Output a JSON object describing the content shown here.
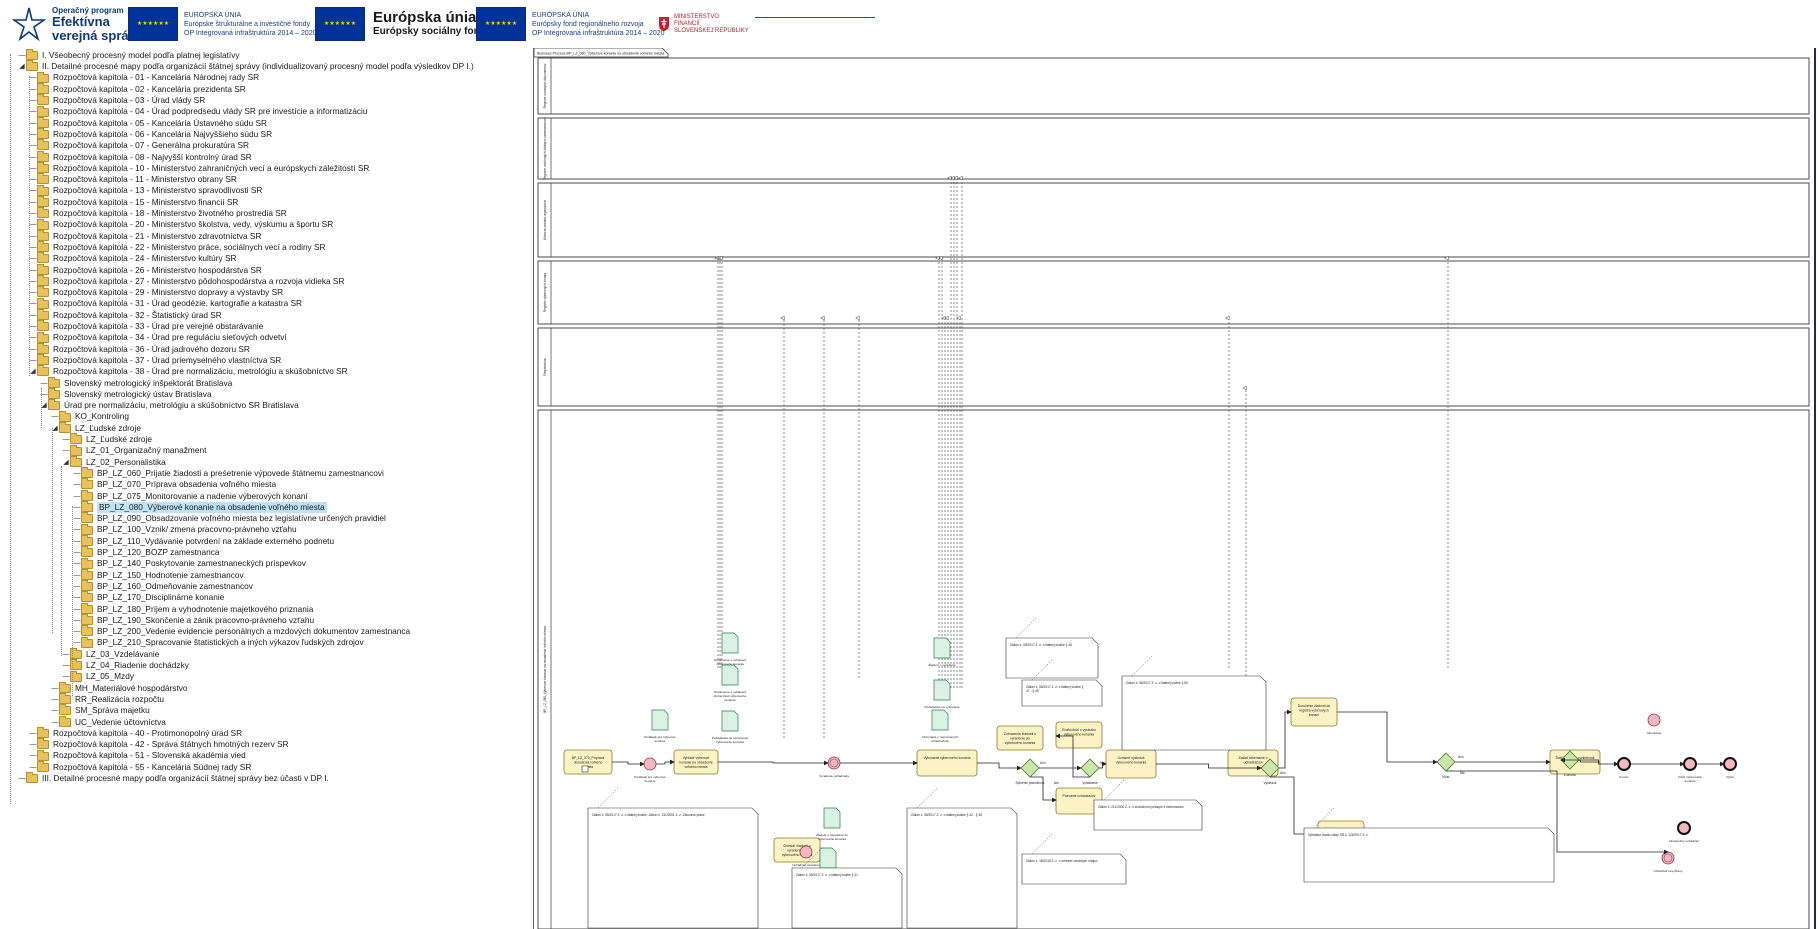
{
  "header": {
    "ovs": {
      "line1": "Operačný program",
      "line2": "Efektívna",
      "line3": "verejná správa"
    },
    "eu1": {
      "t1": "EURÓPSKA ÚNIA",
      "t2": "Európske štrukturálne a investičné fondy",
      "t3": "OP Integrovaná infraštruktúra 2014 – 2020"
    },
    "esf": {
      "title": "Európska únia",
      "sub": "Európsky sociálny fond"
    },
    "eu2": {
      "t1": "EURÓPSKA ÚNIA",
      "t2": "Európsky fond regionálneho rozvoja",
      "t3": "OP Integrovaná infraštruktúra 2014 – 2020"
    },
    "mf": {
      "t1": "MINISTERSTVO",
      "t2": "FINANCIÍ",
      "t3": "SLOVENSKEJ REPUBLIKY"
    },
    "colors": {
      "eu_blue": "#003399",
      "eu_star": "#ffcc00",
      "mf_red": "#b3202a",
      "ovs_blue": "#0d3b7a"
    }
  },
  "tree": [
    {
      "id": "n0",
      "label": "I. Všeobecný procesný model podľa platnej legislatívy",
      "level": 0,
      "toggle": "",
      "selected": false
    },
    {
      "id": "n1",
      "label": "II. Detailné procesné mapy podľa organizácií štátnej správy (individualizovaný procesný model podľa výsledkov DP I.)",
      "level": 0,
      "toggle": "◢",
      "selected": false
    },
    {
      "id": "n2",
      "label": "Rozpočtová kapitola - 01 - Kancelária Národnej rady SR",
      "level": 1,
      "toggle": "",
      "selected": false
    },
    {
      "id": "n3",
      "label": "Rozpočtová kapitola - 02 - Kancelária prezidenta SR",
      "level": 1,
      "toggle": "",
      "selected": false
    },
    {
      "id": "n4",
      "label": "Rozpočtová kapitola - 03 - Úrad vlády SR",
      "level": 1,
      "toggle": "",
      "selected": false
    },
    {
      "id": "n5",
      "label": "Rozpočtová kapitola - 04 - Úrad podpredsedu vlády SR pre investície a informatizáciu",
      "level": 1,
      "toggle": "",
      "selected": false
    },
    {
      "id": "n6",
      "label": "Rozpočtová kapitola - 05 - Kancelária Ústavného súdu SR",
      "level": 1,
      "toggle": "",
      "selected": false
    },
    {
      "id": "n7",
      "label": "Rozpočtová kapitola - 06 - Kancelária Najvyššieho súdu SR",
      "level": 1,
      "toggle": "",
      "selected": false
    },
    {
      "id": "n8",
      "label": "Rozpočtová kapitola - 07 - Generálna prokuratúra SR",
      "level": 1,
      "toggle": "",
      "selected": false
    },
    {
      "id": "n9",
      "label": "Rozpočtová kapitola - 08 - Najvyšší kontrolný úrad SR",
      "level": 1,
      "toggle": "",
      "selected": false
    },
    {
      "id": "n10",
      "label": "Rozpočtová kapitola - 10 - Ministerstvo zahraničných vecí a európskych záležitostí SR",
      "level": 1,
      "toggle": "",
      "selected": false
    },
    {
      "id": "n11",
      "label": "Rozpočtová kapitola - 11 - Ministerstvo obrany SR",
      "level": 1,
      "toggle": "",
      "selected": false
    },
    {
      "id": "n12",
      "label": "Rozpočtová kapitola - 13 - Ministerstvo spravodlivosti SR",
      "level": 1,
      "toggle": "",
      "selected": false
    },
    {
      "id": "n13",
      "label": "Rozpočtová kapitola - 15 - Ministerstvo financií SR",
      "level": 1,
      "toggle": "",
      "selected": false
    },
    {
      "id": "n14",
      "label": "Rozpočtová kapitola - 18 - Ministerstvo životného prostredia SR",
      "level": 1,
      "toggle": "",
      "selected": false
    },
    {
      "id": "n15",
      "label": "Rozpočtová kapitola - 20 - Ministerstvo školstva, vedy, výskumu a športu SR",
      "level": 1,
      "toggle": "",
      "selected": false
    },
    {
      "id": "n16",
      "label": "Rozpočtová kapitola - 21 - Ministerstvo zdravotníctva SR",
      "level": 1,
      "toggle": "",
      "selected": false
    },
    {
      "id": "n17",
      "label": "Rozpočtová kapitola - 22 - Ministerstvo práce, sociálnych vecí a rodiny SR",
      "level": 1,
      "toggle": "",
      "selected": false
    },
    {
      "id": "n18",
      "label": "Rozpočtová kapitola - 24 - Ministerstvo kultúry SR",
      "level": 1,
      "toggle": "",
      "selected": false
    },
    {
      "id": "n19",
      "label": "Rozpočtová kapitola - 26 - Ministerstvo hospodárstva SR",
      "level": 1,
      "toggle": "",
      "selected": false
    },
    {
      "id": "n20",
      "label": "Rozpočtová kapitola - 27 - Ministerstvo pôdohospodárstva a rozvoja vidieka SR",
      "level": 1,
      "toggle": "",
      "selected": false
    },
    {
      "id": "n21",
      "label": "Rozpočtová kapitola - 29 - Ministerstvo dopravy a výstavby SR",
      "level": 1,
      "toggle": "",
      "selected": false
    },
    {
      "id": "n22",
      "label": "Rozpočtová kapitola - 31 - Úrad geodézie, kartografie a katastra SR",
      "level": 1,
      "toggle": "",
      "selected": false
    },
    {
      "id": "n23",
      "label": "Rozpočtová kapitola - 32 - Štatistický úrad SR",
      "level": 1,
      "toggle": "",
      "selected": false
    },
    {
      "id": "n24",
      "label": "Rozpočtová kapitola - 33 - Úrad pre verejné obstarávanie",
      "level": 1,
      "toggle": "",
      "selected": false
    },
    {
      "id": "n25",
      "label": "Rozpočtová kapitola - 34 - Úrad pre reguláciu sieťových odvetví",
      "level": 1,
      "toggle": "",
      "selected": false
    },
    {
      "id": "n26",
      "label": "Rozpočtová kapitola - 36 - Úrad jadrového dozoru SR",
      "level": 1,
      "toggle": "",
      "selected": false
    },
    {
      "id": "n27",
      "label": "Rozpočtová kapitola - 37 - Úrad priemyselného vlastníctva SR",
      "level": 1,
      "toggle": "",
      "selected": false
    },
    {
      "id": "n28",
      "label": "Rozpočtová kapitola - 38 - Úrad pre normalizáciu, metrológiu a skúšobníctvo SR",
      "level": 1,
      "toggle": "◢",
      "selected": false
    },
    {
      "id": "n29",
      "label": "Slovenský metrologický inšpektorát Bratislava",
      "level": 2,
      "toggle": "",
      "selected": false
    },
    {
      "id": "n30",
      "label": "Slovenský metrologický ústav Bratislava",
      "level": 2,
      "toggle": "",
      "selected": false
    },
    {
      "id": "n31",
      "label": "Úrad pre normalizáciu, metrológiu a skúšobníctvo SR Bratislava",
      "level": 2,
      "toggle": "◢",
      "selected": false
    },
    {
      "id": "n32",
      "label": "KO_Kontroling",
      "level": 3,
      "toggle": "",
      "selected": false
    },
    {
      "id": "n33",
      "label": "LZ_Ľudské zdroje",
      "level": 3,
      "toggle": "◢",
      "selected": false
    },
    {
      "id": "n34",
      "label": "LZ_Ľudské zdroje",
      "level": 4,
      "toggle": "",
      "selected": false
    },
    {
      "id": "n35",
      "label": "LZ_01_Organizačný manažment",
      "level": 4,
      "toggle": "",
      "selected": false
    },
    {
      "id": "n36",
      "label": "LZ_02_Personalistika",
      "level": 4,
      "toggle": "◢",
      "selected": false
    },
    {
      "id": "n37",
      "label": "BP_LZ_060_Prijatie žiadosti a preśetrenie výpovede štátnemu zamestnancovi",
      "level": 5,
      "toggle": "",
      "selected": false
    },
    {
      "id": "n38",
      "label": "BP_LZ_070_Príprava obsadenia voľného miesta",
      "level": 5,
      "toggle": "",
      "selected": false
    },
    {
      "id": "n39",
      "label": "BP_LZ_075_Monitorovanie a nadenie výberových konaní",
      "level": 5,
      "toggle": "",
      "selected": false
    },
    {
      "id": "n40",
      "label": "BP_LZ_080_Výberové konanie na obsadenie voľného miesta",
      "level": 5,
      "toggle": "",
      "selected": true
    },
    {
      "id": "n41",
      "label": "BP_LZ_090_Obsadzovanie voľného miesta bez legislatívne určených pravidiel",
      "level": 5,
      "toggle": "",
      "selected": false
    },
    {
      "id": "n42",
      "label": "BP_LZ_100_Vznik/ zmena pracovno-právneho vzťahu",
      "level": 5,
      "toggle": "",
      "selected": false
    },
    {
      "id": "n43",
      "label": "BP_LZ_110_Vydávanie potvrdení na základe externého podnetu",
      "level": 5,
      "toggle": "",
      "selected": false
    },
    {
      "id": "n44",
      "label": "BP_LZ_120_BOZP zamestnanca",
      "level": 5,
      "toggle": "",
      "selected": false
    },
    {
      "id": "n45",
      "label": "BP_LZ_140_Poskytovanie zamestnaneckých príspevkov",
      "level": 5,
      "toggle": "",
      "selected": false
    },
    {
      "id": "n46",
      "label": "BP_LZ_150_Hodnotenie zamestnancov",
      "level": 5,
      "toggle": "",
      "selected": false
    },
    {
      "id": "n47",
      "label": "BP_LZ_160_Odmeňovanie zamestnancov",
      "level": 5,
      "toggle": "",
      "selected": false
    },
    {
      "id": "n48",
      "label": "BP_LZ_170_Disciplinárne konanie",
      "level": 5,
      "toggle": "",
      "selected": false
    },
    {
      "id": "n49",
      "label": "BP_LZ_180_Príjem a vyhodnotenie majetkového priznania",
      "level": 5,
      "toggle": "",
      "selected": false
    },
    {
      "id": "n50",
      "label": "BP_LZ_190_Skončenie a zánik pracovno-právneho vzťahu",
      "level": 5,
      "toggle": "",
      "selected": false
    },
    {
      "id": "n51",
      "label": "BP_LZ_200_Vedenie evidencie personálnych a mzdových dokumentov zamestnanca",
      "level": 5,
      "toggle": "",
      "selected": false
    },
    {
      "id": "n52",
      "label": "BP_LZ_210_Spracovanie štatistických a iných výkazov ľudských zdrojov",
      "level": 5,
      "toggle": "",
      "selected": false
    },
    {
      "id": "n53",
      "label": "LZ_03_Vzdelávanie",
      "level": 4,
      "toggle": "",
      "selected": false
    },
    {
      "id": "n54",
      "label": "LZ_04_Riadenie dochádzky",
      "level": 4,
      "toggle": "",
      "selected": false
    },
    {
      "id": "n55",
      "label": "LZ_05_Mzdy",
      "level": 4,
      "toggle": "",
      "selected": false
    },
    {
      "id": "n56",
      "label": "MH_Materiálové hospodárstvo",
      "level": 3,
      "toggle": "",
      "selected": false
    },
    {
      "id": "n57",
      "label": "RR_Realizácia rozpočtu",
      "level": 3,
      "toggle": "",
      "selected": false
    },
    {
      "id": "n58",
      "label": "SM_Správa majetku",
      "level": 3,
      "toggle": "",
      "selected": false
    },
    {
      "id": "n59",
      "label": "UC_Vedenie účtovníctva",
      "level": 3,
      "toggle": "",
      "selected": false
    },
    {
      "id": "n60",
      "label": "Rozpočtová kapitola - 40 - Protimonopolný úrad SR",
      "level": 1,
      "toggle": "",
      "selected": false
    },
    {
      "id": "n61",
      "label": "Rozpočtová kapitola - 42 - Správa štátnych hmotných rezerv SR",
      "level": 1,
      "toggle": "",
      "selected": false
    },
    {
      "id": "n62",
      "label": "Rozpočtová kapitola - 51 - Slovenská akadémia vied",
      "level": 1,
      "toggle": "",
      "selected": false
    },
    {
      "id": "n63",
      "label": "Rozpočtová kapitola - 55 - Kancelária Súdnej rady SR",
      "level": 1,
      "toggle": "",
      "selected": false
    },
    {
      "id": "n64",
      "label": "III. Detailné procesné mapy podľa organizácií štátnej správy bez účasti v DP I.",
      "level": 0,
      "toggle": "",
      "selected": false
    }
  ],
  "diagram": {
    "title": "Business Process BP_LZ_080_Výberové konanie na obsadenie voľného miesta",
    "lanes": [
      {
        "id": "l1",
        "label": "Register osobných dokumentov"
      },
      {
        "id": "l2",
        "label": "Register vnútorných štátnych zamestnancov"
      },
      {
        "id": "l3",
        "label": "Webová stránka organizácie"
      },
      {
        "id": "l4",
        "label": "Register výberových konaní"
      },
      {
        "id": "l5",
        "label": "Registratúra"
      },
      {
        "id": "l6",
        "label": "BP_LZ_080_Výberové konanie na obsadenie voľného miesta"
      }
    ],
    "tasks": [
      {
        "id": "t0",
        "label": "BP_LZ_070_Príprava obsadenia voľného miesta"
      },
      {
        "id": "t1",
        "label": "Vyhlásiť výberové konanie na obsadenie voľného miesta"
      },
      {
        "id": "t2",
        "label": "Doručenie žiadosti do registra výberových konaní"
      },
      {
        "id": "t3",
        "label": "Zobrazenie žiadosti o vyradenie do výberového konania"
      },
      {
        "id": "t4",
        "label": "Odoslať žiadosti o vyradenie do výberového konania"
      },
      {
        "id": "t5",
        "label": "Oznámiť uchádzačovi vyradenie z výberového konania"
      },
      {
        "id": "t6",
        "label": "Pozvanie uchádzačov"
      },
      {
        "id": "t7",
        "label": "Vykonanie výberového konania"
      },
      {
        "id": "t8",
        "label": "Rozhodnúť o výsledku výberového konania"
      },
      {
        "id": "t9",
        "label": "Oznámiť výsledok výberového konania"
      },
      {
        "id": "t10",
        "label": "Zaslať informácie o uchádzačovi"
      },
      {
        "id": "t11",
        "label": "Ďalší splnenie podmienok"
      }
    ],
    "docs": [
      {
        "id": "d1",
        "label": "Podklady pre výberové konanie"
      },
      {
        "id": "d2",
        "label": "Oznámenie o vyhlásení výberového konania"
      },
      {
        "id": "d3",
        "label": "Oznámenie o vyhlásení druhej časti výberového konania"
      },
      {
        "id": "d4",
        "label": "Požiadavka na oznámenie výberového konania"
      },
      {
        "id": "d5",
        "label": "Požiadavka na zaradenie do registra"
      },
      {
        "id": "d6",
        "label": "Žiadosť o zaradenie do výberového konania"
      },
      {
        "id": "d7",
        "label": "Informácia o nepozvaných uchádzačoch"
      },
      {
        "id": "d8",
        "label": "Žiadosť o vyradenie"
      },
      {
        "id": "d9",
        "label": "Požiadavka na vykonanie"
      }
    ],
    "gateways": [
      "Splnenie podmienok",
      "Vyhlásenie",
      "Výsledok",
      "Víťaz",
      "Dohoda"
    ],
    "edge_labels": [
      "Áno",
      "Nie",
      "Nie",
      "Áno",
      "Áno",
      "Nie"
    ],
    "notes": [
      {
        "id": "nt1",
        "label": "Zákon č. 55/2017 Z. z. o štátnej službe; Zákon č. 311/2001 Z. z. Zákonník práce"
      },
      {
        "id": "nt2",
        "label": "Zákon č. 55/2017 Z. z. o štátnej službe § 41"
      },
      {
        "id": "nt3",
        "label": "Zákon č. 55/2017 Z. z. o štátnej službe § 42 - § 45"
      },
      {
        "id": "nt4",
        "label": "Zákon č. 55/2017 Z. z. o štátnej službe § 46"
      },
      {
        "id": "nt5",
        "label": "Zákon č. 55/2017 Z. z. o štátnej službe § 47 - § 49"
      },
      {
        "id": "nt6",
        "label": "Zákon č. 55/2017 Z. z. o štátnej službe § 50"
      },
      {
        "id": "nt7",
        "label": "Zákon č. 18/2018 Z. z. o ochrane osobných údajov"
      },
      {
        "id": "nt8",
        "label": "Zákon č. 211/2000 Z. z. o slobodnom prístupe k informáciám"
      },
      {
        "id": "nt9",
        "label": "Vyhláška Úradu vlády SR č. 126/2017 Z. z."
      }
    ],
    "event_labels": [
      "Podklady pre výberové konanie",
      "Uchádzač zaradený",
      "Vyradenie uchádzača",
      "Uchádzač nevybraný",
      "Koniec",
      "Víťaz výberového konania",
      "Výber",
      "Ukončenie",
      "Neúspešný uchádzač"
    ],
    "colors": {
      "task_fill": "#fcf3c4",
      "task_stroke": "#8a7a2a",
      "doc_fill": "#d9f2e2",
      "gateway_fill": "#c9e6a8",
      "event_red": "#f4b7c0",
      "lane_stroke": "#3b3b3b",
      "arrow": "#222222"
    }
  }
}
